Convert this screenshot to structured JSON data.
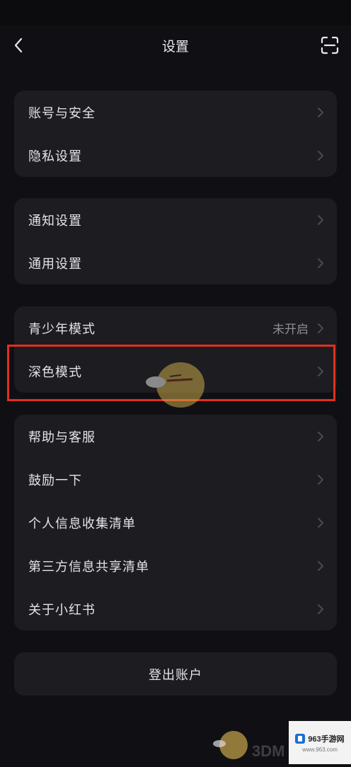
{
  "header": {
    "title": "设置",
    "back_icon": "chevron-left-icon",
    "scan_icon": "scan-icon"
  },
  "groups": [
    {
      "items": [
        {
          "label": "账号与安全"
        },
        {
          "label": "隐私设置"
        }
      ]
    },
    {
      "items": [
        {
          "label": "通知设置"
        },
        {
          "label": "通用设置"
        }
      ]
    },
    {
      "items": [
        {
          "label": "青少年模式",
          "value": "未开启"
        },
        {
          "label": "深色模式",
          "highlighted": true
        }
      ]
    },
    {
      "items": [
        {
          "label": "帮助与客服"
        },
        {
          "label": "鼓励一下"
        },
        {
          "label": "个人信息收集清单"
        },
        {
          "label": "第三方信息共享清单"
        },
        {
          "label": "关于小红书"
        }
      ]
    }
  ],
  "logout": {
    "label": "登出账户"
  },
  "watermarks": {
    "left_text": "3DM",
    "right_brand": "963手游网",
    "right_url": "www.963.com"
  },
  "colors": {
    "background": "#101014",
    "card": "#1c1c21",
    "highlight": "#e0301f",
    "secondary_text": "#8c8c92"
  }
}
